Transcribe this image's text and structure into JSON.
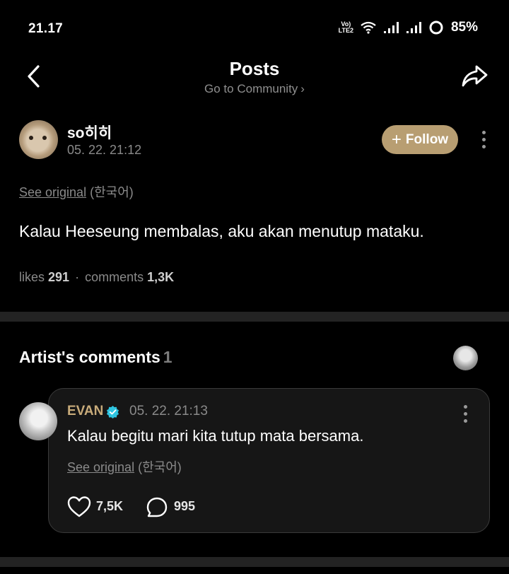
{
  "status_bar": {
    "time": "21.17",
    "network_label_top": "Vo)",
    "network_label_bottom": "LTE2",
    "battery": "85%"
  },
  "header": {
    "title": "Posts",
    "subtitle": "Go to Community",
    "subtitle_chevron": "›"
  },
  "post": {
    "author_name": "so히히",
    "timestamp": "05. 22. 21:12",
    "follow_plus": "+",
    "follow_label": "Follow",
    "see_original": "See original",
    "original_language": "(한국어)",
    "body": "Kalau Heeseung membalas, aku akan menutup mataku.",
    "likes_label": "likes",
    "likes_count": "291",
    "stats_separator": "·",
    "comments_label": "comments",
    "comments_count": "1,3K"
  },
  "artist_comments": {
    "title": "Artist's comments",
    "count": "1"
  },
  "comment": {
    "author": "EVAN",
    "timestamp": "05. 22. 21:13",
    "body": "Kalau begitu mari kita tutup mata bersama.",
    "see_original": "See original",
    "original_language": "(한국어)",
    "likes": "7,5K",
    "replies": "995"
  },
  "colors": {
    "background": "#000000",
    "follow_button": "#b89e72",
    "artist_name": "#c8ab7a",
    "verified_badge": "#2ec4e0",
    "divider": "#232323"
  }
}
